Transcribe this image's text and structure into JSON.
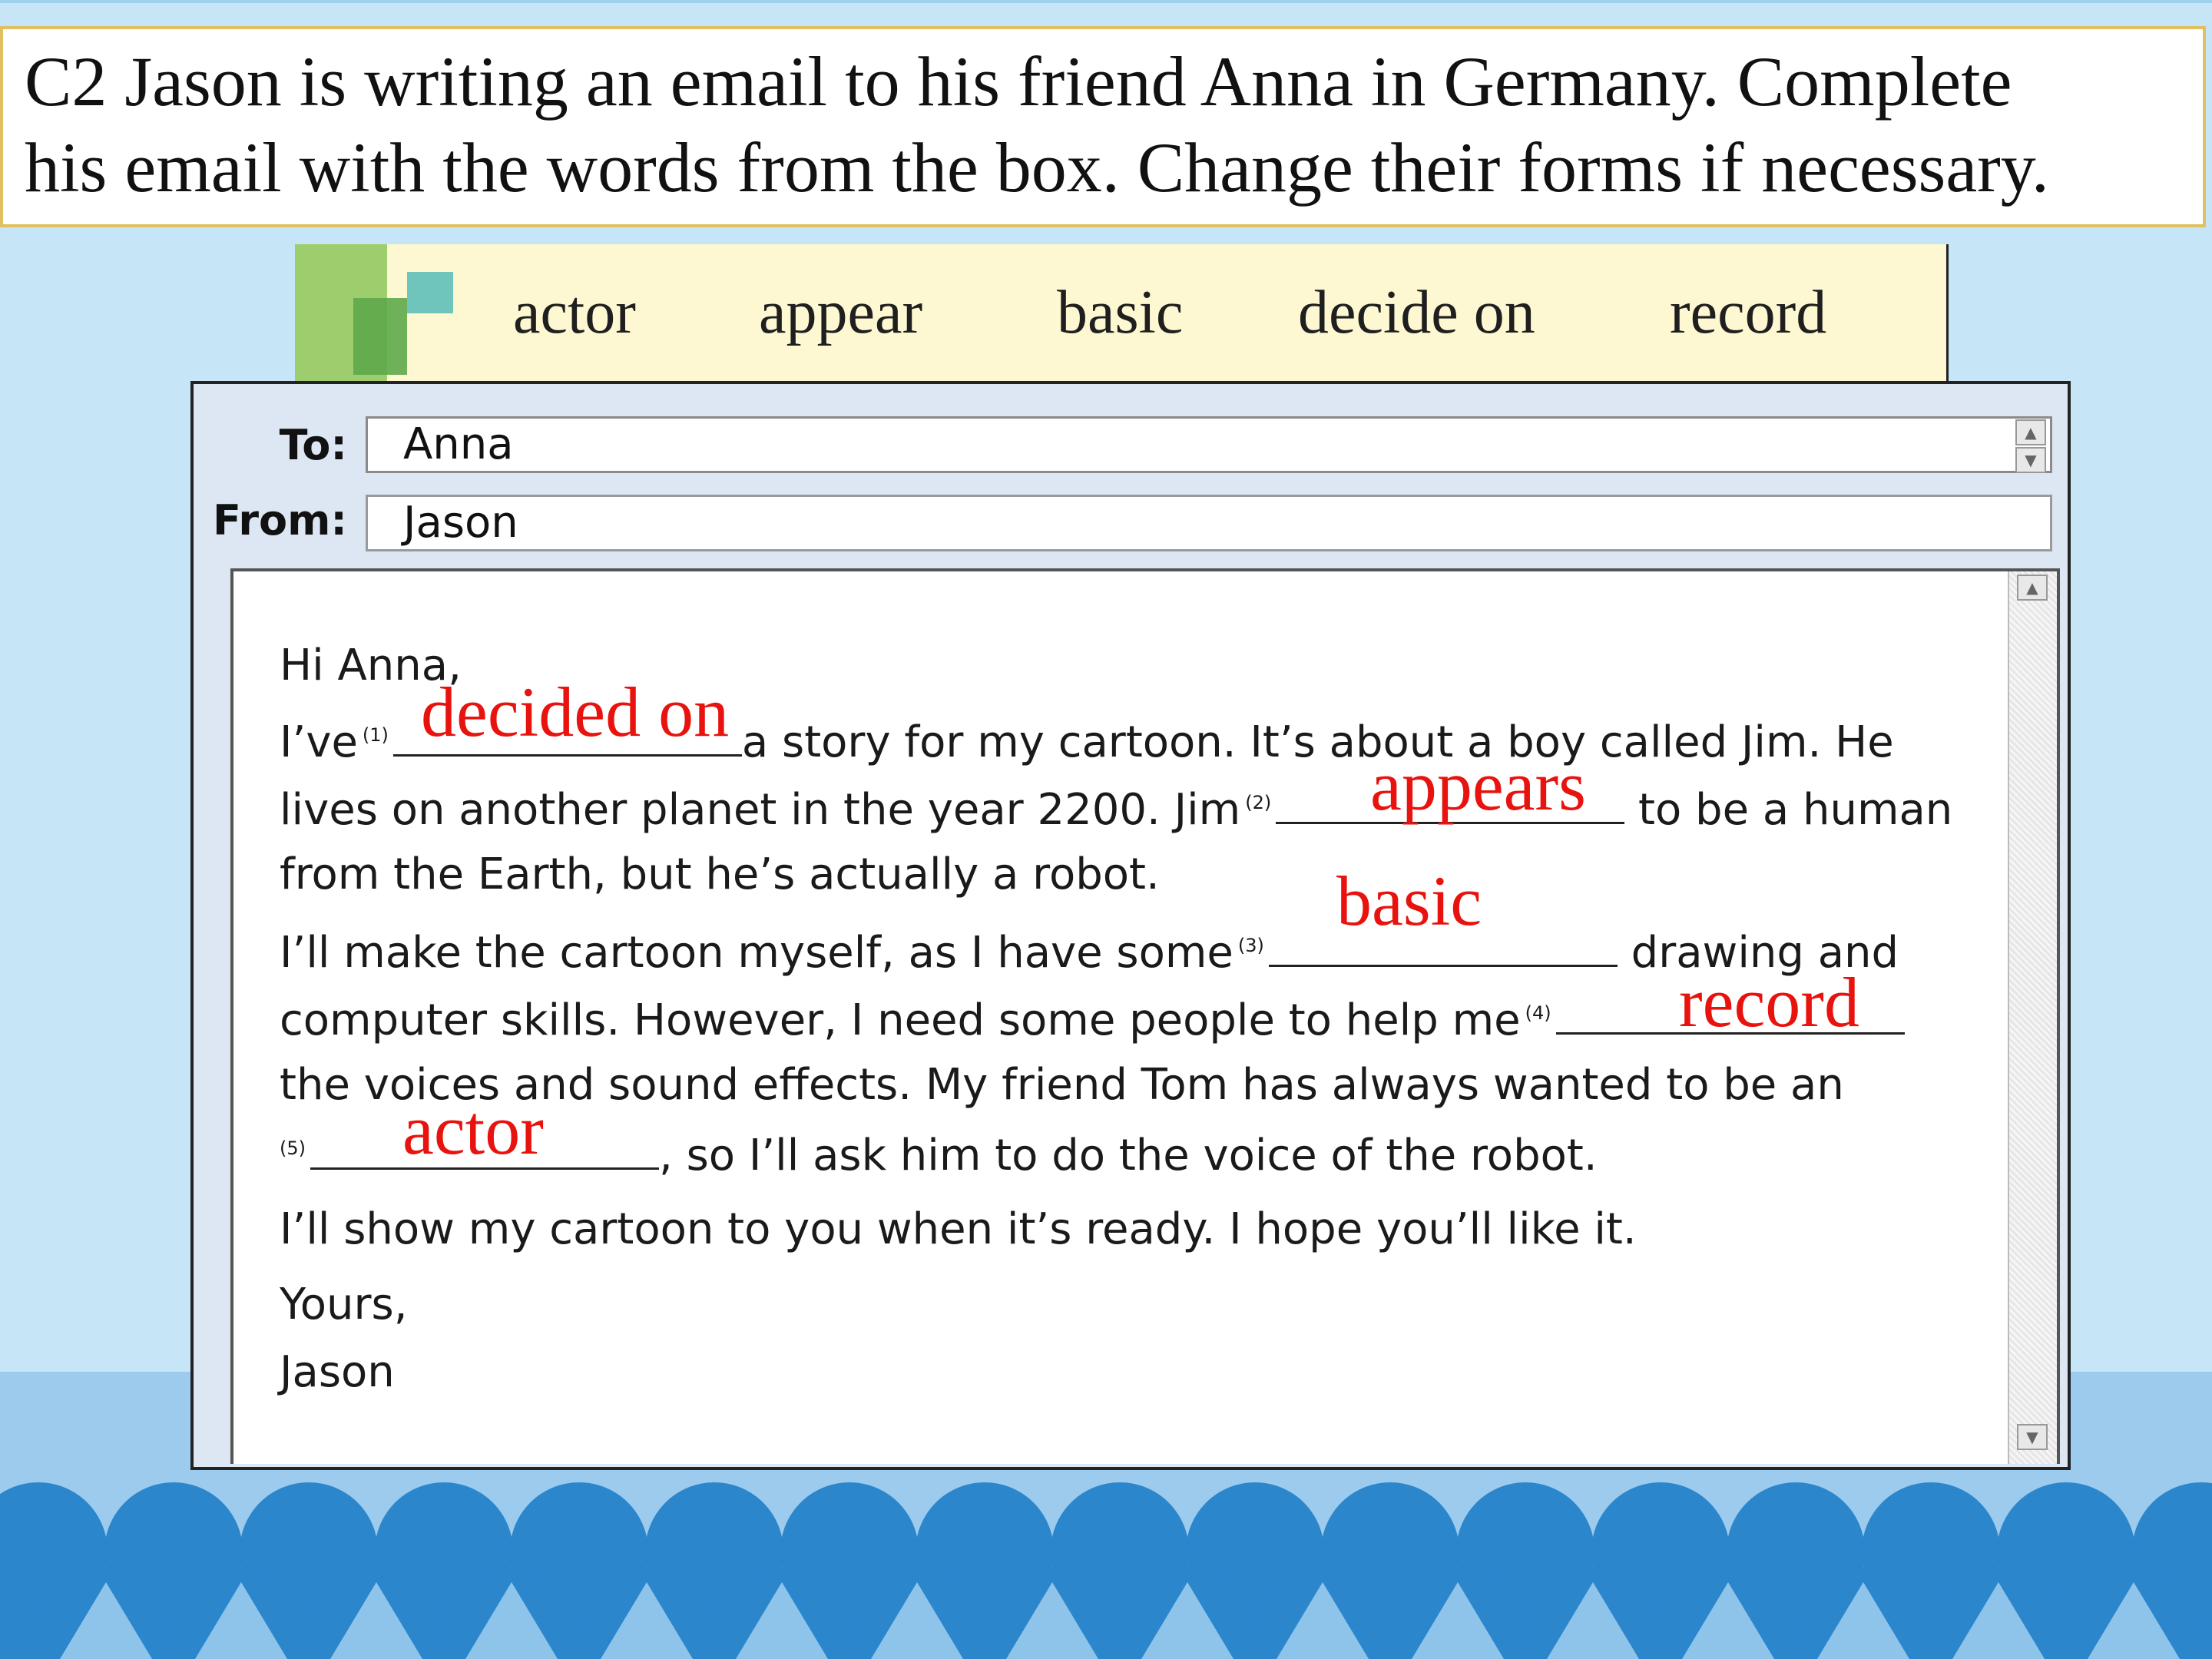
{
  "instruction": {
    "line1": "C2  Jason is writing an email to his friend Anna in Germany. Complete",
    "line2": "his email with the words from the box. Change their forms if necessary."
  },
  "word_box": [
    "actor",
    "appear",
    "basic",
    "decide on",
    "record"
  ],
  "email": {
    "to_label": "To:",
    "to_value": "Anna",
    "from_label": "From:",
    "from_value": "Jason",
    "greeting": "Hi Anna,",
    "line1_pre": "I’ve",
    "line1_post": "a story for my cartoon. It’s about a boy called Jim. He",
    "line2_pre": "lives on another planet in the year 2200. Jim",
    "line2_post": "to be a human",
    "line3": "from the Earth, but he’s actually a robot.",
    "line4_pre": "I’ll make the cartoon myself, as I have some",
    "line4_post": "drawing and",
    "line5_pre": "computer skills. However, I need some people to help me",
    "line6": "the voices and sound effects. My friend Tom has always wanted to be an",
    "line7_post": ", so I’ll ask him to do the voice of the robot.",
    "line8": "I’ll show my cartoon to you when it’s ready. I hope you’ll like it.",
    "closing": "Yours,",
    "signature": "Jason",
    "blank_numbers": [
      "(1)",
      "(2)",
      "(3)",
      "(4)",
      "(5)"
    ]
  },
  "answers": [
    "decided on",
    "appears",
    "basic",
    "record",
    "actor"
  ],
  "colors": {
    "answer": "#e8130e",
    "background": "#c6e6f7",
    "scallop": "#2b86cc"
  }
}
